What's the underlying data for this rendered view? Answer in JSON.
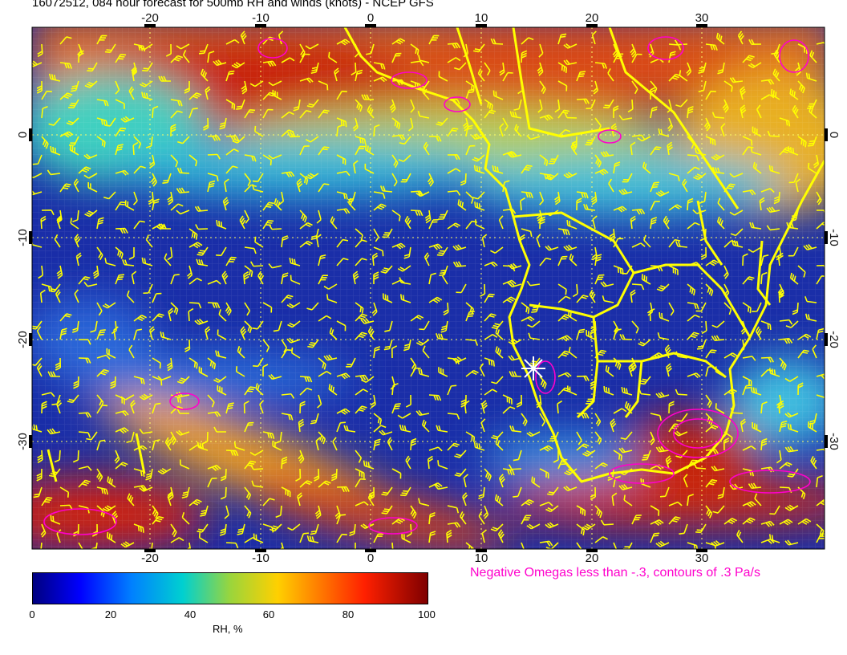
{
  "title": "16072512, 084 hour forecast for 500mb RH and winds (knots) - NCEP GFS",
  "map": {
    "lon_ticks": [
      "-20",
      "-10",
      "0",
      "10",
      "20",
      "30"
    ],
    "lat_ticks": [
      "0",
      "-10",
      "-20",
      "-30"
    ],
    "lon_range": [
      -30,
      40
    ],
    "lat_range": [
      -40,
      10
    ],
    "colors": {
      "coast": "#ffff00",
      "barbs": "#ffff00",
      "omega": "#ff00cc",
      "station": "#ffffff"
    }
  },
  "omega_note": "Negative Omegas less than -.3, contours of .3 Pa/s",
  "colorbar": {
    "ticks": [
      "0",
      "20",
      "40",
      "60",
      "80",
      "100"
    ],
    "label": "RH, %"
  }
}
